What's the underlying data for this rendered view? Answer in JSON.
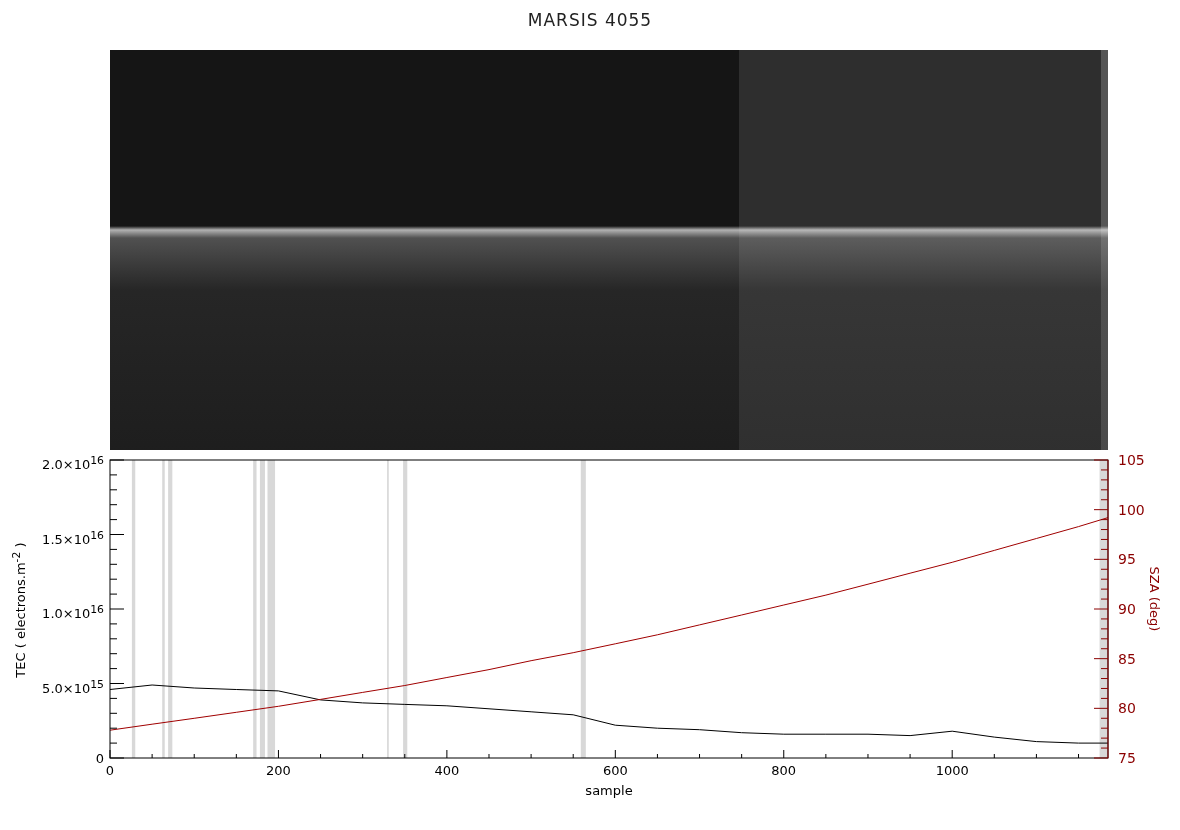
{
  "title": "MARSIS 4055",
  "radargram": {
    "kind": "image"
  },
  "chart_data": {
    "type": "line",
    "xlabel": "sample",
    "ylabel": "TEC ( electrons.m$^{-2}$ )",
    "y2label": "SZA (deg)",
    "x": [
      0,
      50,
      100,
      150,
      200,
      250,
      300,
      350,
      400,
      450,
      500,
      550,
      600,
      650,
      700,
      750,
      800,
      850,
      900,
      950,
      1000,
      1050,
      1100,
      1150,
      1185
    ],
    "series": [
      {
        "color": "#000000",
        "values": [
          4600000000000000.0,
          4900000000000000.0,
          4700000000000000.0,
          4600000000000000.0,
          4500000000000000.0,
          3900000000000000.0,
          3700000000000000.0,
          3600000000000000.0,
          3500000000000000.0,
          3300000000000000.0,
          3100000000000000.0,
          2900000000000000.0,
          2200000000000000.0,
          2000000000000000.0,
          1900000000000000.0,
          1700000000000000.0,
          1600000000000000.0,
          1600000000000000.0,
          1600000000000000.0,
          1500000000000000.0,
          1800000000000000.0,
          1400000000000000.0,
          1100000000000000.0,
          1000000000000000.0,
          1000000000000000.0
        ]
      },
      {
        "color": "#a00000",
        "axis": "y2",
        "values": [
          77.8,
          78.4,
          79,
          79.6,
          80.2,
          80.9,
          81.6,
          82.3,
          83.1,
          83.9,
          84.8,
          85.6,
          86.5,
          87.4,
          88.4,
          89.4,
          90.4,
          91.4,
          92.5,
          93.6,
          94.7,
          95.9,
          97.1,
          98.3,
          99.2
        ]
      }
    ],
    "xlim": [
      0,
      1185
    ],
    "ylim": [
      0,
      2e+16
    ],
    "y2lim": [
      75,
      105
    ],
    "xticks": [
      0,
      200,
      400,
      600,
      800,
      1000
    ],
    "yticks": [
      {
        "value": 0,
        "label": "0"
      },
      {
        "value": 5000000000000000.0,
        "label": "5.0×10$^{15}$"
      },
      {
        "value": 1e+16,
        "label": "1.0×10$^{16}$"
      },
      {
        "value": 1.5e+16,
        "label": "1.5×10$^{16}$"
      },
      {
        "value": 2e+16,
        "label": "2.0×10$^{16}$"
      }
    ],
    "y2ticks": [
      75,
      80,
      85,
      90,
      95,
      100,
      105
    ],
    "bands": [
      {
        "axis": "x",
        "from": 26,
        "to": 30
      },
      {
        "axis": "x",
        "from": 62,
        "to": 65
      },
      {
        "axis": "x",
        "from": 69,
        "to": 74
      },
      {
        "axis": "x",
        "from": 170,
        "to": 174
      },
      {
        "axis": "x",
        "from": 178,
        "to": 184
      },
      {
        "axis": "x",
        "from": 187,
        "to": 196
      },
      {
        "axis": "x",
        "from": 329,
        "to": 331
      },
      {
        "axis": "x",
        "from": 348,
        "to": 353
      },
      {
        "axis": "x",
        "from": 559,
        "to": 565
      },
      {
        "axis": "x",
        "from": 1175,
        "to": 1185
      }
    ]
  }
}
